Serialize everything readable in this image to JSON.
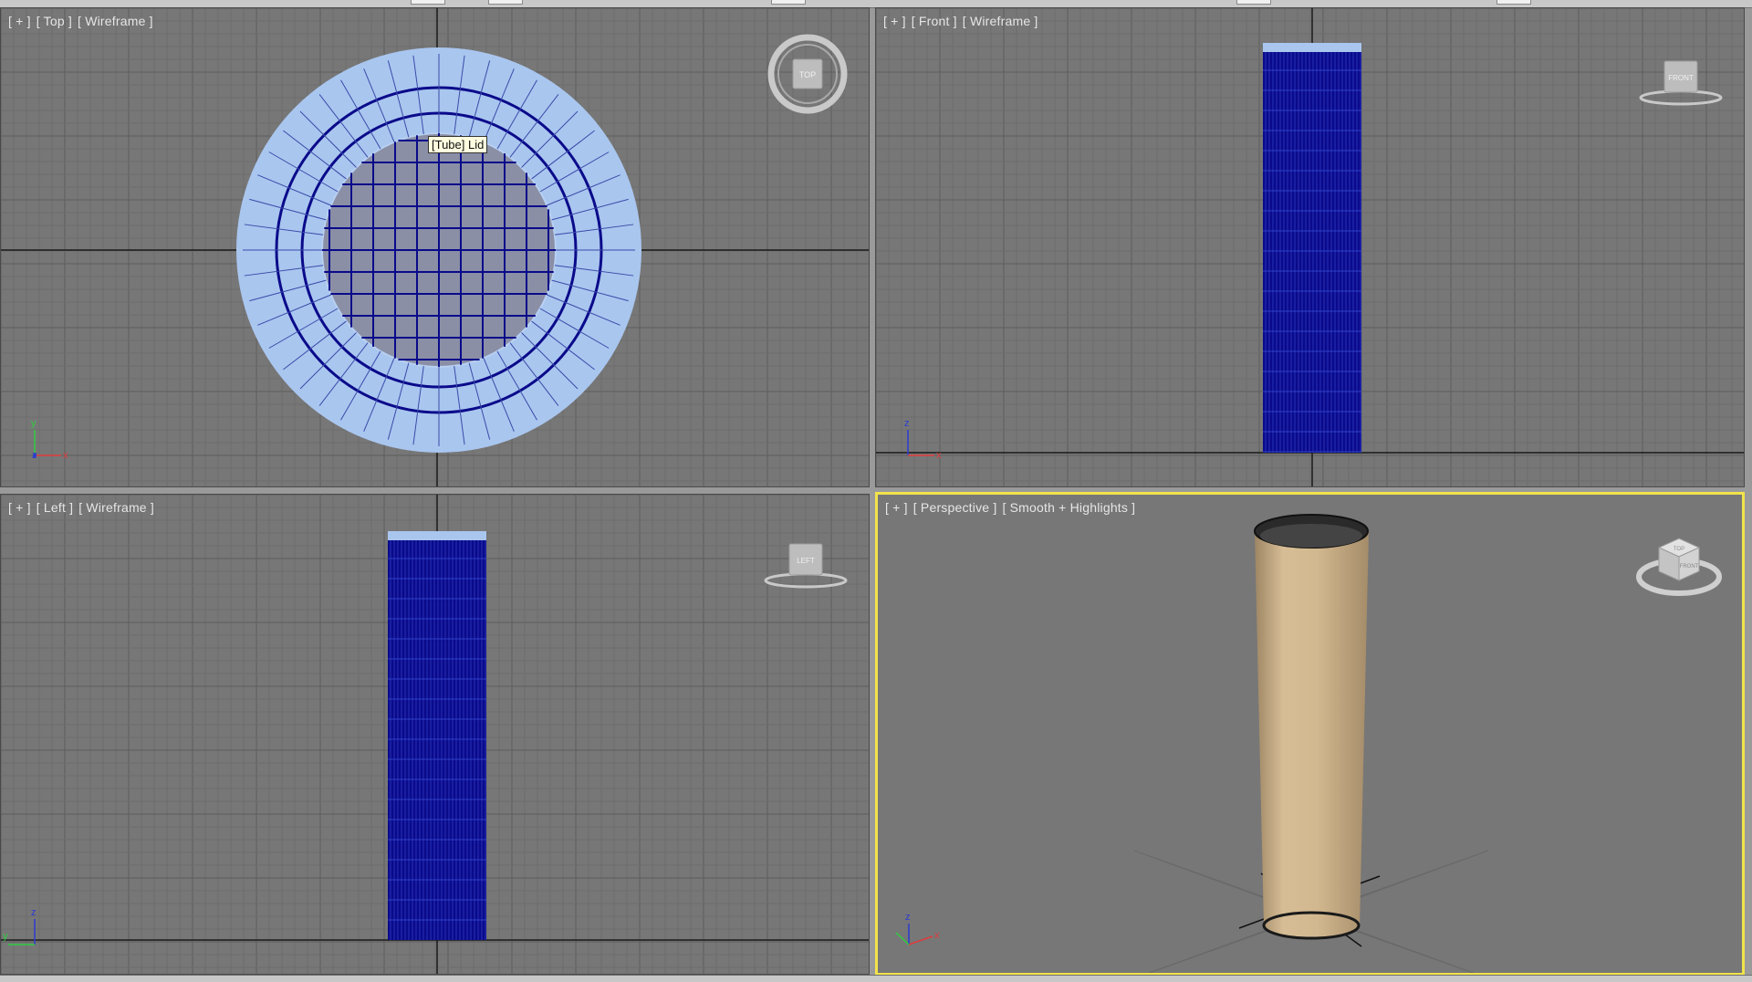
{
  "viewports": {
    "top": {
      "menu": "[ + ]",
      "view": "[ Top ]",
      "shading": "[ Wireframe ]",
      "cube_label": "TOP",
      "axis_v": "y",
      "axis_h": "x",
      "axis_c": "z"
    },
    "front": {
      "menu": "[ + ]",
      "view": "[ Front ]",
      "shading": "[ Wireframe ]",
      "cube_label": "FRONT",
      "axis_v": "z",
      "axis_h": "x"
    },
    "left": {
      "menu": "[ + ]",
      "view": "[ Left ]",
      "shading": "[ Wireframe ]",
      "cube_label": "LEFT",
      "axis_v": "z",
      "axis_h": "y"
    },
    "perspective": {
      "menu": "[ + ]",
      "view": "[ Perspective ]",
      "shading": "[ Smooth + Highlights ]",
      "axis_v": "z",
      "axis_h": "x",
      "cube_top": "TOP",
      "cube_front": "FRONT"
    }
  },
  "tooltip": {
    "text": "[Tube] Lid"
  },
  "colors": {
    "viewport_bg": "#777777",
    "grid": "#6b6b6b",
    "grid_major": "#5c5c5c",
    "axis_line": "#1a1a1a",
    "wire_blue": "#0a0a8a",
    "selection_light": "#a9c6ef",
    "active_border": "#f2e34a",
    "tube_surface": "#d2b88f"
  }
}
